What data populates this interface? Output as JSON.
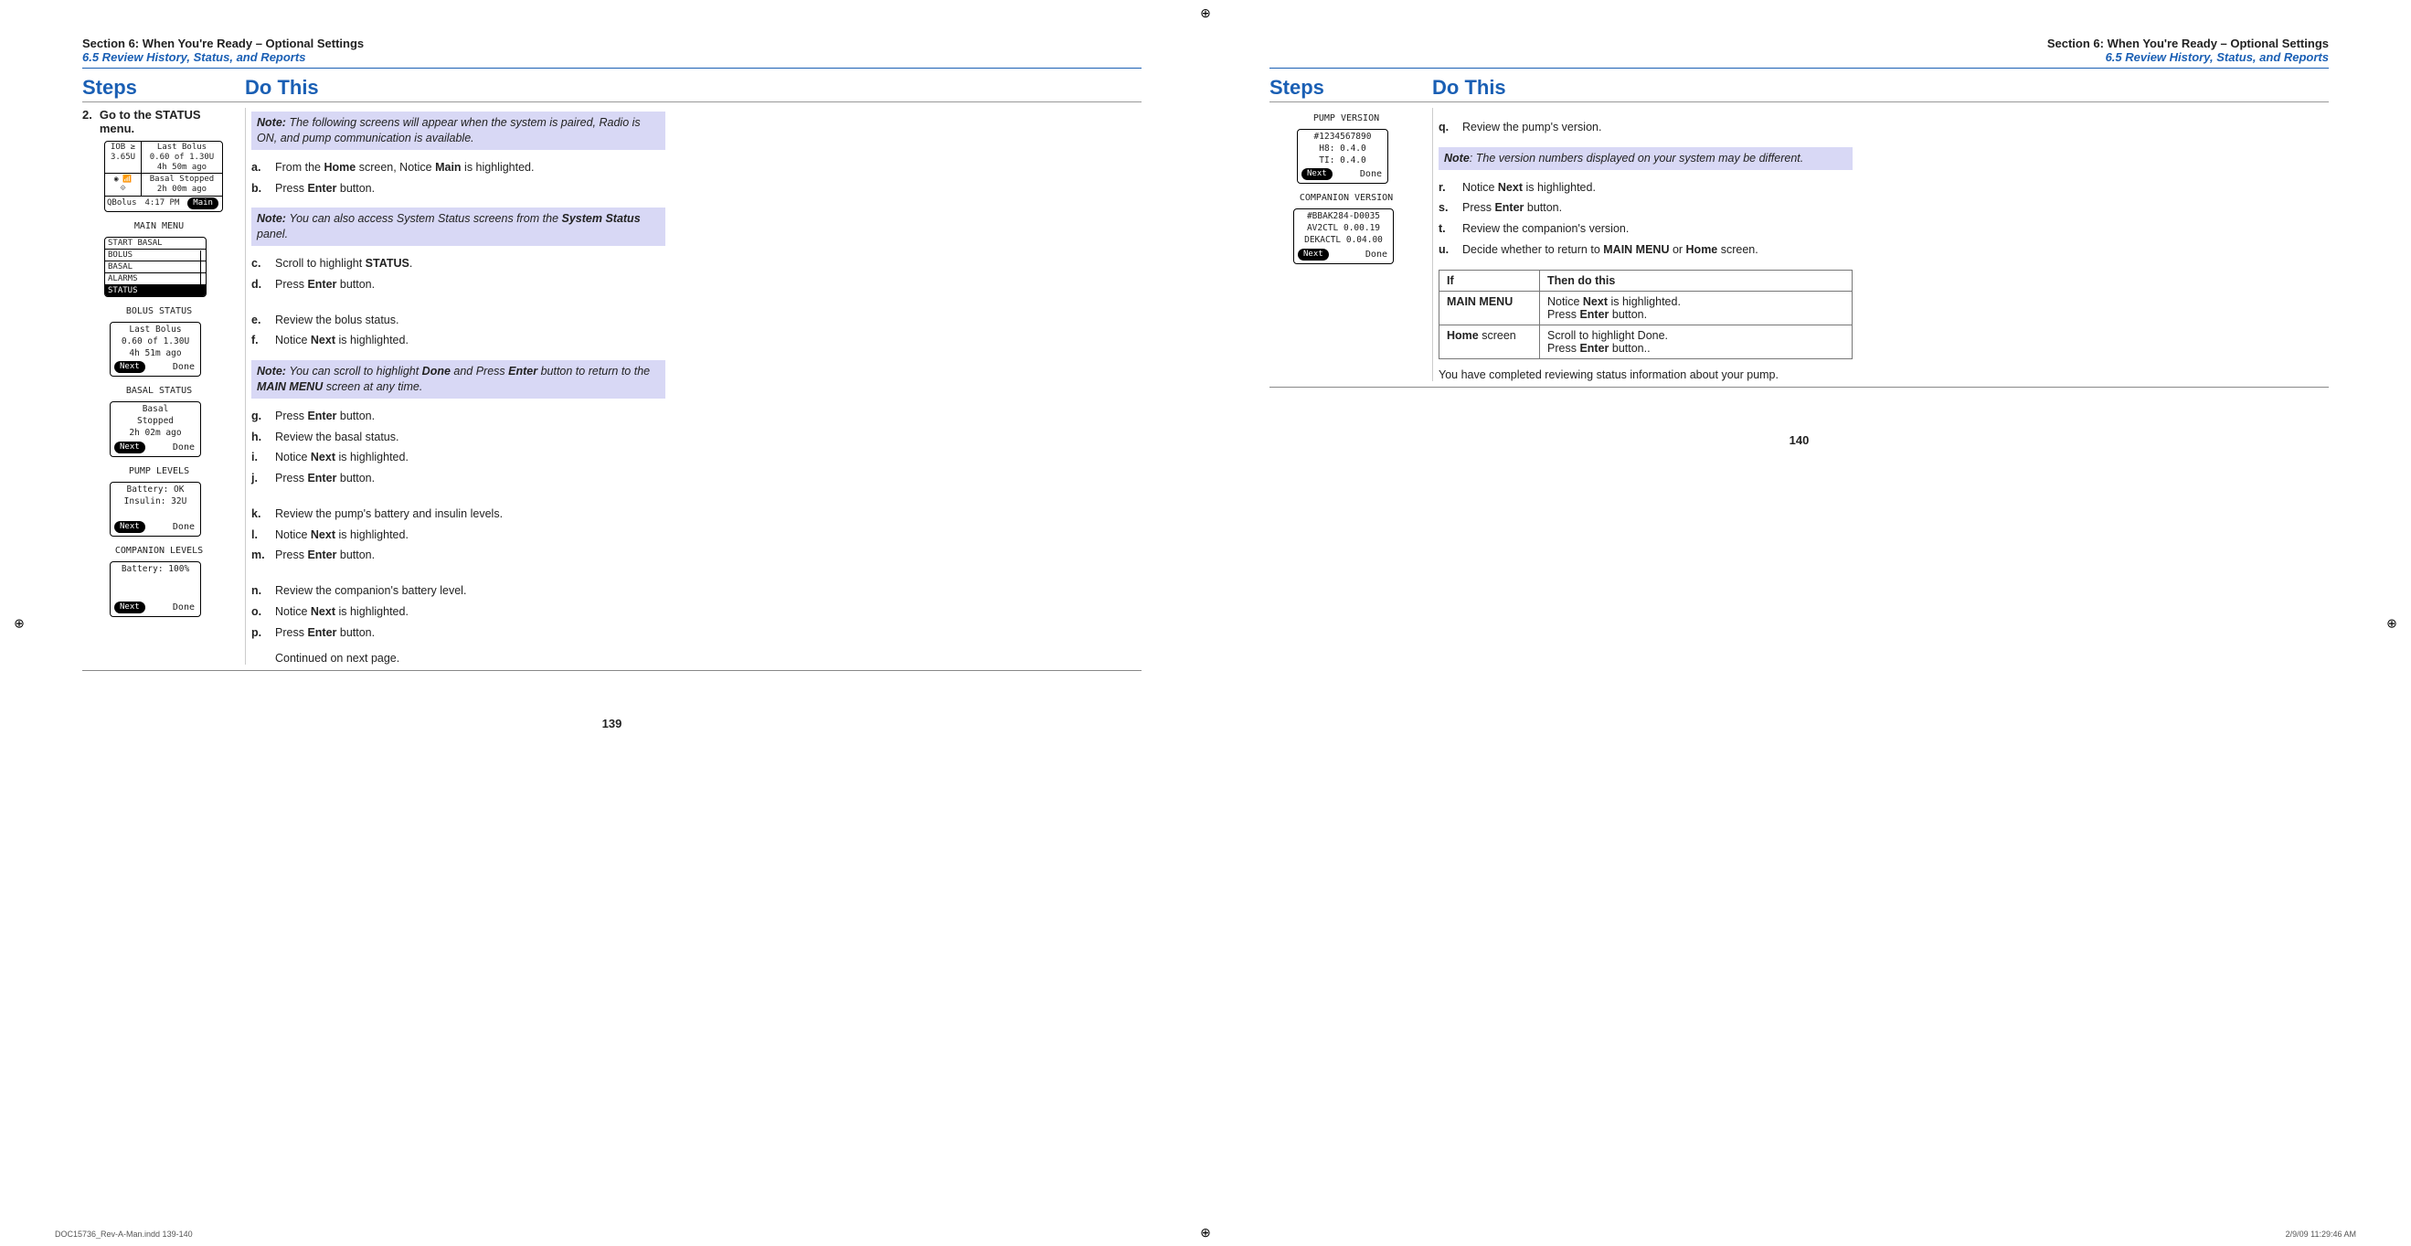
{
  "header": {
    "section": "Section 6: When You're Ready – Optional Settings",
    "subsection": "6.5 Review History, Status, and Reports"
  },
  "columns": {
    "steps": "Steps",
    "dothis": "Do This"
  },
  "left": {
    "step_num": "2.",
    "step_text": "Go to the STATUS menu.",
    "note1_label": "Note:",
    "note1_body": "The following screens will appear when the system is paired, Radio is ON, and pump communication is available.",
    "a_pre": "From the ",
    "a_b1": "Home",
    "a_mid": " screen, Notice ",
    "a_b2": "Main",
    "a_post": " is highlighted.",
    "b_pre": "Press ",
    "b_b": "Enter",
    "b_post": " button.",
    "note2_label": "Note:",
    "note2_body_pre": "You can also access System Status screens from the ",
    "note2_b": "System Status",
    "note2_body_post": " panel.",
    "c_pre": "Scroll to highlight ",
    "c_b": "STATUS",
    "c_post": ".",
    "d_pre": "Press ",
    "d_b": "Enter",
    "d_post": " button.",
    "e": "Review the bolus status.",
    "f_pre": "Notice ",
    "f_b": "Next",
    "f_post": " is highlighted.",
    "note3_label": "Note:",
    "note3_pre": "You can scroll to highlight ",
    "note3_b1": "Done",
    "note3_mid": " and Press ",
    "note3_b2": "Enter",
    "note3_mid2": " button to return to the ",
    "note3_b3": "MAIN MENU",
    "note3_post": " screen at any time.",
    "g_pre": "Press ",
    "g_b": "Enter",
    "g_post": " button.",
    "h": "Review the basal status.",
    "i_pre": "Notice ",
    "i_b": "Next",
    "i_post": " is highlighted.",
    "j_pre": "Press ",
    "j_b": "Enter",
    "j_post": " button.",
    "k": "Review the pump's battery and insulin levels.",
    "l_pre": "Notice ",
    "l_b": "Next",
    "l_post": " is highlighted.",
    "m_pre": "Press ",
    "m_b": "Enter",
    "m_post": " button.",
    "n": "Review the companion's battery level.",
    "o_pre": "Notice ",
    "o_b": "Next",
    "o_post": " is highlighted.",
    "p_pre": "Press ",
    "p_b": "Enter",
    "p_post": " button.",
    "continued": "Continued on next page."
  },
  "right": {
    "q": "Review the pump's version.",
    "noteR_label": "Note",
    "noteR_body": ": The version numbers displayed on your system may be different.",
    "r_pre": "Notice ",
    "r_b": "Next",
    "r_post": " is highlighted.",
    "s_pre": "Press ",
    "s_b": "Enter",
    "s_post": " button.",
    "t": "Review the companion's version.",
    "u_pre": "Decide whether to return to ",
    "u_b1": "MAIN MENU",
    "u_mid": " or ",
    "u_b2": "Home",
    "u_post": " screen.",
    "table": {
      "h1": "If",
      "h2": "Then do this",
      "r1c1": "MAIN MENU",
      "r1c2_l1_pre": "Notice ",
      "r1c2_l1_b": "Next",
      "r1c2_l1_post": " is highlighted.",
      "r1c2_l2_pre": "Press ",
      "r1c2_l2_b": "Enter",
      "r1c2_l2_post": " button.",
      "r2c1_b": "Home",
      "r2c1_post": " screen",
      "r2c2_l1": "Scroll to highlight Done.",
      "r2c2_l2_pre": "Press ",
      "r2c2_l2_b": "Enter",
      "r2c2_l2_post": " button.."
    },
    "closing": "You have completed reviewing status information about your pump."
  },
  "screens": {
    "home": {
      "iob_label": "IOB ≥",
      "iob_val": "3.65U",
      "lb_title": "Last Bolus",
      "lb_l1": "0.60 of 1.30U",
      "lb_l2": "4h 50m ago",
      "basal_title": "Basal Stopped",
      "basal_l1": "2h 00m ago",
      "bottom_l": "QBolus",
      "bottom_m": "4:17 PM",
      "bottom_r": "Main"
    },
    "mainmenu": {
      "title": "MAIN MENU",
      "items": [
        "START BASAL",
        "BOLUS",
        "BASAL",
        "ALARMS",
        "STATUS"
      ]
    },
    "bolus": {
      "title": "BOLUS STATUS",
      "l1": "Last Bolus",
      "l2": "0.60 of 1.30U",
      "l3": "4h 51m ago",
      "next": "Next",
      "done": "Done"
    },
    "basal": {
      "title": "BASAL STATUS",
      "l1": "Basal",
      "l2": "Stopped",
      "l3": "2h 02m ago",
      "next": "Next",
      "done": "Done"
    },
    "pumplevels": {
      "title": "PUMP LEVELS",
      "l1": "Battery: OK",
      "l2": "Insulin: 32U",
      "next": "Next",
      "done": "Done"
    },
    "complevels": {
      "title": "COMPANION LEVELS",
      "l1": "Battery: 100%",
      "next": "Next",
      "done": "Done"
    },
    "pumpver": {
      "title": "PUMP VERSION",
      "l1": "#1234567890",
      "l2": "H8: 0.4.0",
      "l3": "TI: 0.4.0",
      "next": "Next",
      "done": "Done"
    },
    "compver": {
      "title": "COMPANION VERSION",
      "l1": "#BBAK284-D0035",
      "l2": "AV2CTL 0.00.19",
      "l3": "DEKACTL 0.04.00",
      "next": "Next",
      "done": "Done"
    }
  },
  "pagenums": {
    "left": "139",
    "right": "140"
  },
  "footer": {
    "left": "DOC15736_Rev-A-Man.indd   139-140",
    "right": "2/9/09   11:29:46 AM"
  }
}
